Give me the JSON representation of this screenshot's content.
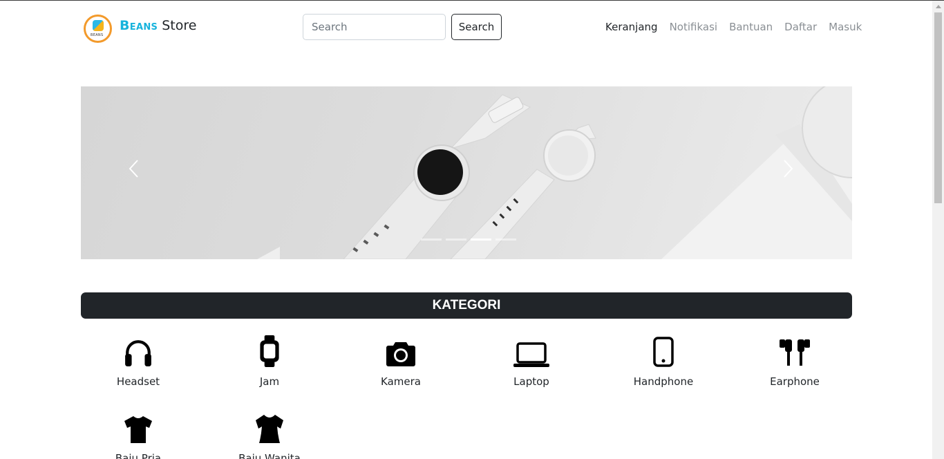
{
  "header": {
    "brand_highlight": "Beans",
    "brand_rest": "Store",
    "logo_text": "BEANS",
    "search_placeholder": "Search",
    "search_button": "Search",
    "nav": [
      "Keranjang",
      "Notifikasi",
      "Bantuan",
      "Daftar",
      "Masuk"
    ]
  },
  "carousel": {
    "prev_icon": "chevron-left-icon",
    "next_icon": "chevron-right-icon",
    "slide_count": 4,
    "active_slide": 3
  },
  "section": {
    "title": "KATEGORI"
  },
  "categories": [
    {
      "label": "Headset",
      "icon": "headphones-icon"
    },
    {
      "label": "Jam",
      "icon": "smartwatch-icon"
    },
    {
      "label": "Kamera",
      "icon": "camera-icon"
    },
    {
      "label": "Laptop",
      "icon": "laptop-icon"
    },
    {
      "label": "Handphone",
      "icon": "phone-icon"
    },
    {
      "label": "Earphone",
      "icon": "earbuds-icon"
    },
    {
      "label": "Baju Pria",
      "icon": "tshirt-icon"
    },
    {
      "label": "Baju Wanita",
      "icon": "blouse-icon"
    }
  ],
  "colors": {
    "brand_accent": "#17b3dc",
    "logo_ring": "#f39a2b",
    "dark": "#212529",
    "nav_muted": "#8a8f94"
  }
}
